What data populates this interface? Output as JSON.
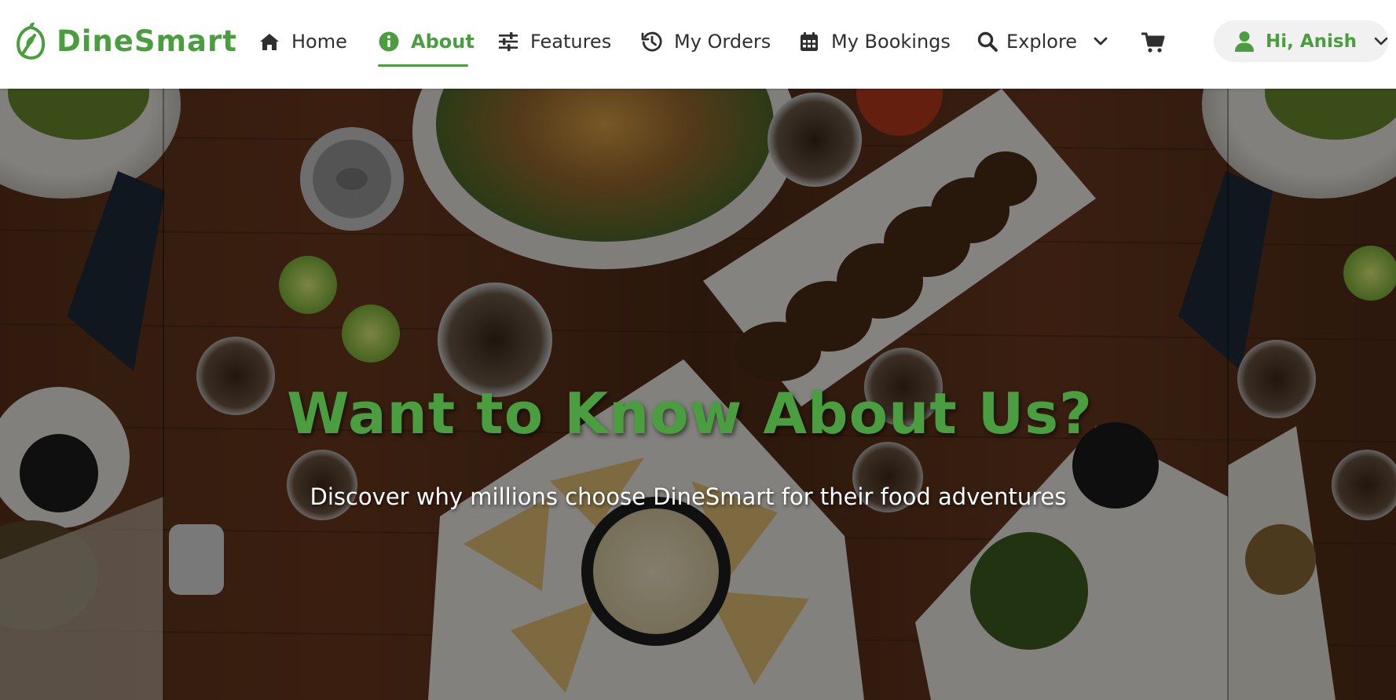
{
  "brand": {
    "name": "DineSmart",
    "logo_icon": "leaf-fork-logo-icon"
  },
  "nav": {
    "items": [
      {
        "label": "Home",
        "icon": "home-icon",
        "active": false
      },
      {
        "label": "About",
        "icon": "info-circle-icon",
        "active": true
      },
      {
        "label": "Features",
        "icon": "sliders-icon",
        "active": false
      },
      {
        "label": "My Orders",
        "icon": "history-icon",
        "active": false
      },
      {
        "label": "My Bookings",
        "icon": "calendar-icon",
        "active": false
      },
      {
        "label": "Explore",
        "icon": "search-icon",
        "active": false,
        "dropdown": true
      }
    ],
    "cart_icon": "cart-icon"
  },
  "user": {
    "greeting": "Hi, Anish",
    "icon": "user-icon"
  },
  "hero": {
    "title": "Want to Know About Us?",
    "subtitle": "Discover why millions choose DineSmart for their food adventures"
  },
  "colors": {
    "accent": "#4a9e3f",
    "nav_text": "#2f2f2f",
    "pill_bg": "#f1f1f1"
  }
}
